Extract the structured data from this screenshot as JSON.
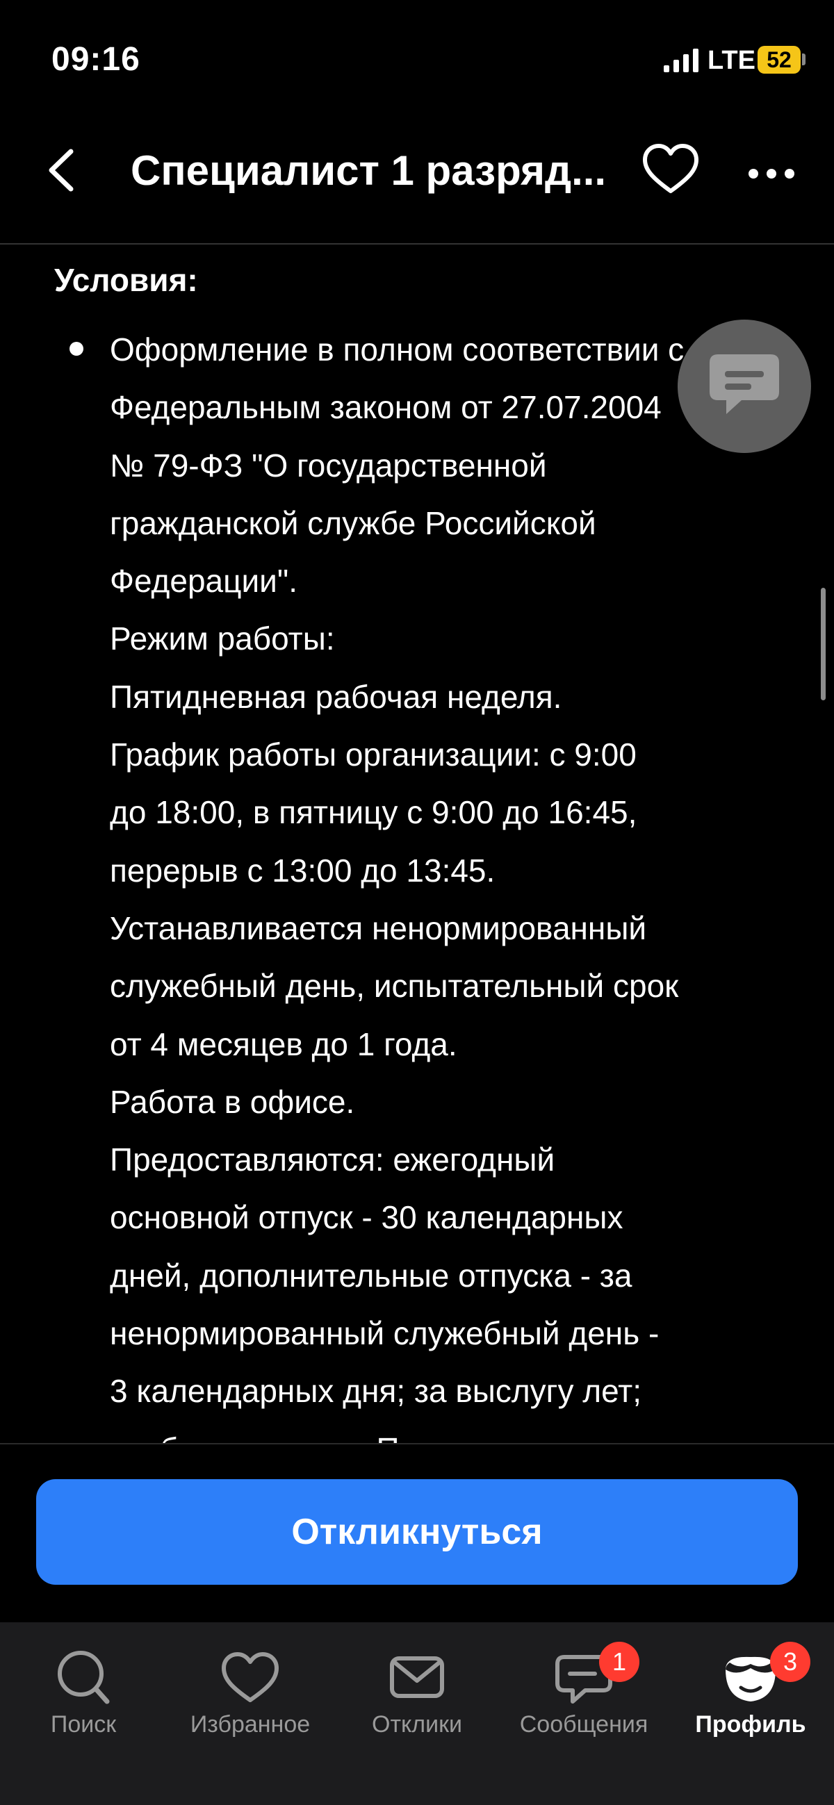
{
  "status_bar": {
    "time": "09:16",
    "network": "LTE",
    "battery": "52"
  },
  "header": {
    "title": "Специалист 1 разряд..."
  },
  "content": {
    "section_title": "Условия:",
    "conditions_lines": [
      "Оформление в полном соответствии с",
      "Федеральным законом от 27.07.2004",
      "№ 79-ФЗ \"О государственной",
      "гражданской службе Российской",
      "Федерации\".",
      "Режим работы:",
      "Пятидневная рабочая неделя.",
      "График работы организации: с 9:00",
      "до 18:00, в пятницу с 9:00 до 16:45,",
      "перерыв с 13:00 до 13:45.",
      "Устанавливается ненормированный",
      "служебный день, испытательный срок",
      "от 4 месяцев до 1 года.",
      "Работа в офисе.",
      "Предоставляются: ежегодный",
      "основной отпуск - 30 календарных",
      "дней, дополнительные отпуска - за",
      "ненормированный служебный день -",
      "3 календарных дня; за выслугу лет;",
      "учебные отпуска. Повышение"
    ]
  },
  "action": {
    "respond_label": "Откликнуться"
  },
  "tabs": [
    {
      "label": "Поиск",
      "icon": "search-icon"
    },
    {
      "label": "Избранное",
      "icon": "heart-icon"
    },
    {
      "label": "Отклики",
      "icon": "envelope-icon"
    },
    {
      "label": "Сообщения",
      "icon": "chat-bubble-icon",
      "badge": "1"
    },
    {
      "label": "Профиль",
      "icon": "profile-avatar-icon",
      "badge": "3",
      "active": true
    }
  ],
  "colors": {
    "accent": "#2d7ff9",
    "badge": "#ff3b30",
    "battery": "#f5c518"
  }
}
